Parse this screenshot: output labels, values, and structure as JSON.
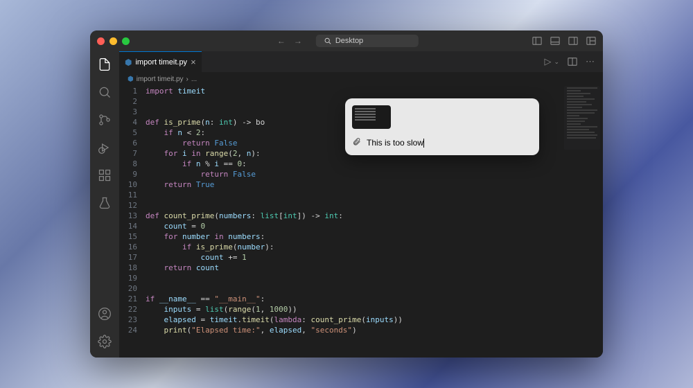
{
  "titlebar": {
    "search_label": "Desktop"
  },
  "tab": {
    "filename": "import timeit.py"
  },
  "breadcrumb": {
    "file": "import timeit.py",
    "sep": "›",
    "rest": "..."
  },
  "code": {
    "lines": [
      {
        "n": 1,
        "html": "<span class='kw'>import</span> <span class='var'>timeit</span>"
      },
      {
        "n": 2,
        "html": ""
      },
      {
        "n": 3,
        "html": ""
      },
      {
        "n": 4,
        "html": "<span class='kw'>def</span> <span class='fn'>is_prime</span>(<span class='var'>n</span>: <span class='type'>int</span>) -> bo"
      },
      {
        "n": 5,
        "html": "    <span class='kw'>if</span> <span class='var'>n</span> &lt; <span class='num'>2</span>:"
      },
      {
        "n": 6,
        "html": "        <span class='kw'>return</span> <span class='const'>False</span>"
      },
      {
        "n": 7,
        "html": "    <span class='kw'>for</span> <span class='var'>i</span> <span class='kw'>in</span> <span class='fn'>range</span>(<span class='num'>2</span>, <span class='var'>n</span>):"
      },
      {
        "n": 8,
        "html": "        <span class='kw'>if</span> <span class='var'>n</span> % <span class='var'>i</span> == <span class='num'>0</span>:"
      },
      {
        "n": 9,
        "html": "            <span class='kw'>return</span> <span class='const'>False</span>"
      },
      {
        "n": 10,
        "html": "    <span class='kw'>return</span> <span class='const'>True</span>"
      },
      {
        "n": 11,
        "html": ""
      },
      {
        "n": 12,
        "html": ""
      },
      {
        "n": 13,
        "html": "<span class='kw'>def</span> <span class='fn'>count_prime</span>(<span class='var'>numbers</span>: <span class='type'>list</span>[<span class='type'>int</span>]) -> <span class='type'>int</span>:"
      },
      {
        "n": 14,
        "html": "    <span class='var'>count</span> = <span class='num'>0</span>"
      },
      {
        "n": 15,
        "html": "    <span class='kw'>for</span> <span class='var'>number</span> <span class='kw'>in</span> <span class='var'>numbers</span>:"
      },
      {
        "n": 16,
        "html": "        <span class='kw'>if</span> <span class='fn'>is_prime</span>(<span class='var'>number</span>):"
      },
      {
        "n": 17,
        "html": "            <span class='var'>count</span> += <span class='num'>1</span>"
      },
      {
        "n": 18,
        "html": "    <span class='kw'>return</span> <span class='var'>count</span>"
      },
      {
        "n": 19,
        "html": ""
      },
      {
        "n": 20,
        "html": ""
      },
      {
        "n": 21,
        "html": "<span class='kw'>if</span> <span class='var'>__name__</span> == <span class='str'>\"__main__\"</span>:"
      },
      {
        "n": 22,
        "html": "    <span class='var'>inputs</span> = <span class='type'>list</span>(<span class='fn'>range</span>(<span class='num'>1</span>, <span class='num'>1000</span>))"
      },
      {
        "n": 23,
        "html": "    <span class='var'>elapsed</span> = <span class='var'>timeit</span>.<span class='fn'>timeit</span>(<span class='kw'>lambda</span>: <span class='fn'>count_prime</span>(<span class='var'>inputs</span>))"
      },
      {
        "n": 24,
        "html": "    <span class='fn'>print</span>(<span class='str'>\"Elapsed time:\"</span>, <span class='var'>elapsed</span>, <span class='str'>\"seconds\"</span>)"
      }
    ]
  },
  "popup": {
    "input_text": "This is too slow"
  }
}
